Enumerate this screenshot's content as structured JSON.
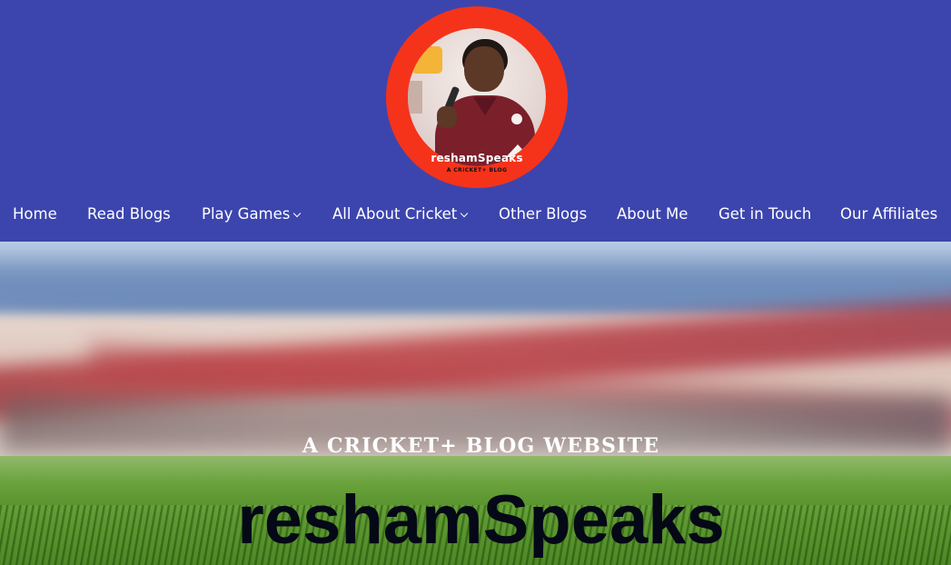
{
  "logo": {
    "name": "reshamSpeaks",
    "tagline": "A CRICKET+ BLOG",
    "colors": {
      "ring": "#f5331a"
    }
  },
  "nav": {
    "items": [
      {
        "label": "Home"
      },
      {
        "label": "Read Blogs"
      },
      {
        "label": "Play Games",
        "dropdown": true,
        "icon": "chevron-down-icon"
      },
      {
        "label": "All About Cricket",
        "dropdown": true,
        "icon": "chevron-down-icon"
      },
      {
        "label": "Other Blogs"
      },
      {
        "label": "About Me"
      },
      {
        "label": "Get in Touch"
      },
      {
        "label": "Our Affiliates"
      }
    ]
  },
  "hero": {
    "subtitle": "A CRICKET+ BLOG WEBSITE",
    "title": "reshamSpeaks"
  },
  "colors": {
    "header_bg": "#3c45ad",
    "nav_text": "#ffffff",
    "hero_title": "#050816"
  }
}
